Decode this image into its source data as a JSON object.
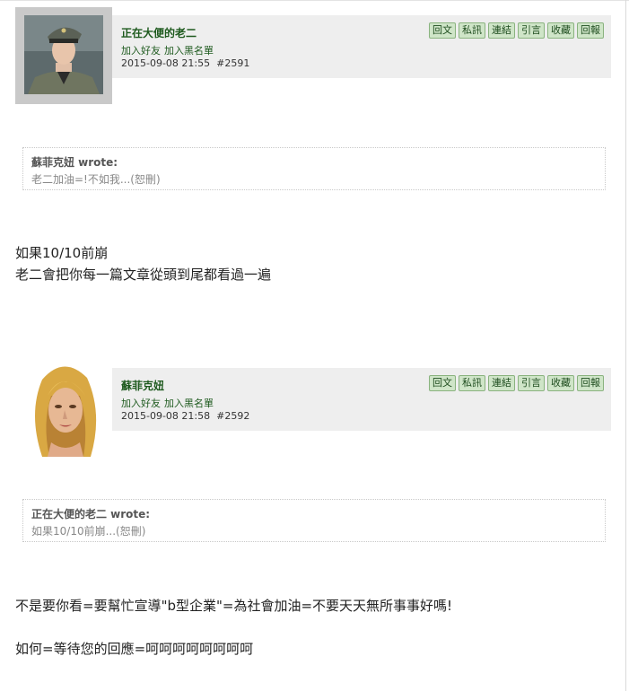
{
  "action_labels": [
    "回文",
    "私訊",
    "連結",
    "引言",
    "收藏",
    "回報"
  ],
  "posts": [
    {
      "author": "正在大便的老二",
      "add_friend": "加入好友",
      "add_blacklist": "加入黑名單",
      "datetime": "2015-09-08 21:55",
      "post_id": "#2591",
      "quote_title": "蘇菲克妞 wrote:",
      "quote_body": "老二加油=!不如我...(恕刪)",
      "body_lines": [
        "如果10/10前崩",
        "老二會把你每一篇文章從頭到尾都看過一遍"
      ]
    },
    {
      "author": "蘇菲克妞",
      "add_friend": "加入好友",
      "add_blacklist": "加入黑名單",
      "datetime": "2015-09-08 21:58",
      "post_id": "#2592",
      "quote_title": "正在大便的老二 wrote:",
      "quote_body": "如果10/10前崩...(恕刪)",
      "body_lines": [
        "不是要你看=要幫忙宣導\"b型企業\"=為社會加油=不要天天無所事事好嗎!",
        "",
        "如何=等待您的回應=呵呵呵呵呵呵呵呵"
      ]
    }
  ]
}
